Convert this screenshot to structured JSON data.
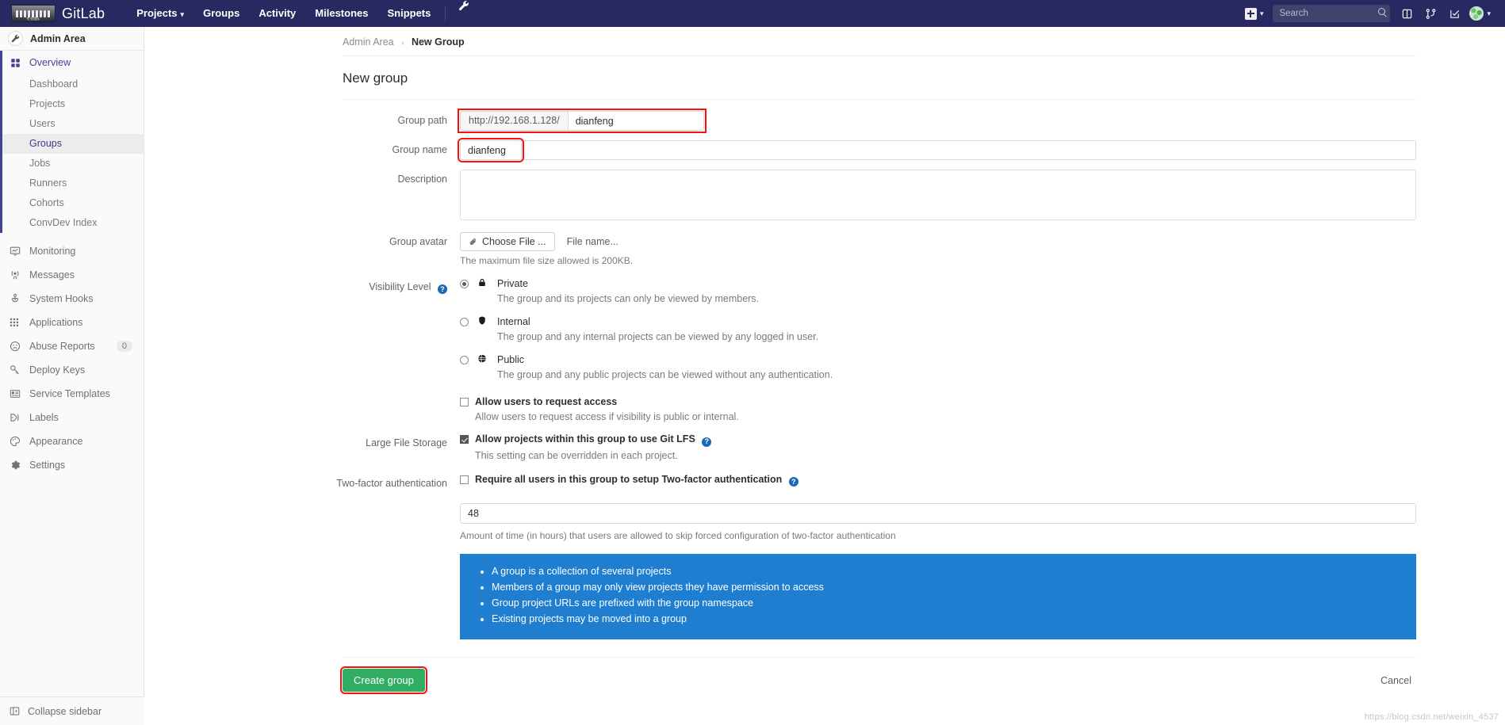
{
  "topnav": {
    "brand": "GitLab",
    "items": [
      {
        "label": "Projects",
        "caret": true
      },
      {
        "label": "Groups",
        "caret": false
      },
      {
        "label": "Activity",
        "caret": false
      },
      {
        "label": "Milestones",
        "caret": false
      },
      {
        "label": "Snippets",
        "caret": false
      }
    ],
    "wrench_icon": "wrench-icon",
    "new_icon": "plus-icon",
    "search": {
      "placeholder": "Search",
      "value": "",
      "icon": "search-icon"
    },
    "right_icons": [
      {
        "name": "issues-icon"
      },
      {
        "name": "merge-requests-icon"
      },
      {
        "name": "todos-icon"
      }
    ],
    "avatar_icon": "user-avatar"
  },
  "sidebar": {
    "header": {
      "title": "Admin Area",
      "icon": "wrench-icon"
    },
    "overview": {
      "label": "Overview",
      "icon": "grid-icon"
    },
    "sub_items": [
      {
        "label": "Dashboard",
        "selected": false
      },
      {
        "label": "Projects",
        "selected": false
      },
      {
        "label": "Users",
        "selected": false
      },
      {
        "label": "Groups",
        "selected": true
      },
      {
        "label": "Jobs",
        "selected": false
      },
      {
        "label": "Runners",
        "selected": false
      },
      {
        "label": "Cohorts",
        "selected": false
      },
      {
        "label": "ConvDev Index",
        "selected": false
      }
    ],
    "items": [
      {
        "label": "Monitoring",
        "icon": "monitor-icon",
        "badge": ""
      },
      {
        "label": "Messages",
        "icon": "broadcast-icon",
        "badge": ""
      },
      {
        "label": "System Hooks",
        "icon": "hook-icon",
        "badge": ""
      },
      {
        "label": "Applications",
        "icon": "apps-grid-icon",
        "badge": ""
      },
      {
        "label": "Abuse Reports",
        "icon": "frown-face-icon",
        "badge": "0"
      },
      {
        "label": "Deploy Keys",
        "icon": "key-icon",
        "badge": ""
      },
      {
        "label": "Service Templates",
        "icon": "template-icon",
        "badge": ""
      },
      {
        "label": "Labels",
        "icon": "label-tag-icon",
        "badge": ""
      },
      {
        "label": "Appearance",
        "icon": "palette-icon",
        "badge": ""
      },
      {
        "label": "Settings",
        "icon": "gear-icon",
        "badge": ""
      }
    ],
    "collapse": {
      "label": "Collapse sidebar",
      "icon": "collapse-icon"
    }
  },
  "breadcrumb": {
    "root": "Admin Area",
    "separator": "›",
    "current": "New Group"
  },
  "page": {
    "title": "New group"
  },
  "form": {
    "group_path": {
      "label": "Group path",
      "prefix": "http://192.168.1.128/",
      "value": "dianfeng",
      "highlighted": true
    },
    "group_name": {
      "label": "Group name",
      "value": "dianfeng",
      "highlighted": true
    },
    "description": {
      "label": "Description",
      "value": "",
      "placeholder": ""
    },
    "group_avatar": {
      "label": "Group avatar",
      "button": "Choose File ...",
      "file_name": "File name...",
      "help": "The maximum file size allowed is 200KB."
    },
    "visibility": {
      "label": "Visibility Level",
      "help_icon": "question-mark-icon",
      "options": [
        {
          "name": "Private",
          "icon": "lock-icon",
          "selected": true,
          "description": "The group and its projects can only be viewed by members."
        },
        {
          "name": "Internal",
          "icon": "shield-icon",
          "selected": false,
          "description": "The group and any internal projects can be viewed by any logged in user."
        },
        {
          "name": "Public",
          "icon": "globe-icon",
          "selected": false,
          "description": "The group and any public projects can be viewed without any authentication."
        }
      ]
    },
    "request_access": {
      "label": "Allow users to request access",
      "checked": false,
      "description": "Allow users to request access if visibility is public or internal."
    },
    "lfs": {
      "label": "Large File Storage",
      "checkbox_label": "Allow projects within this group to use Git LFS",
      "checked": true,
      "description": "This setting can be overridden in each project."
    },
    "two_factor": {
      "label": "Two-factor authentication",
      "checkbox_label": "Require all users in this group to setup Two-factor authentication",
      "checked": false,
      "grace_value": "48",
      "grace_help": "Amount of time (in hours) that users are allowed to skip forced configuration of two-factor authentication"
    }
  },
  "info_panel": {
    "color": "#1f7ed0",
    "bullets": [
      "A group is a collection of several projects",
      "Members of a group may only view projects they have permission to access",
      "Group project URLs are prefixed with the group namespace",
      "Existing projects may be moved into a group"
    ]
  },
  "actions": {
    "create": {
      "label": "Create group",
      "color": "#31ad63",
      "highlighted": true
    },
    "cancel": {
      "label": "Cancel"
    }
  },
  "watermark": "https://blog.csdn.net/weixin_4537"
}
